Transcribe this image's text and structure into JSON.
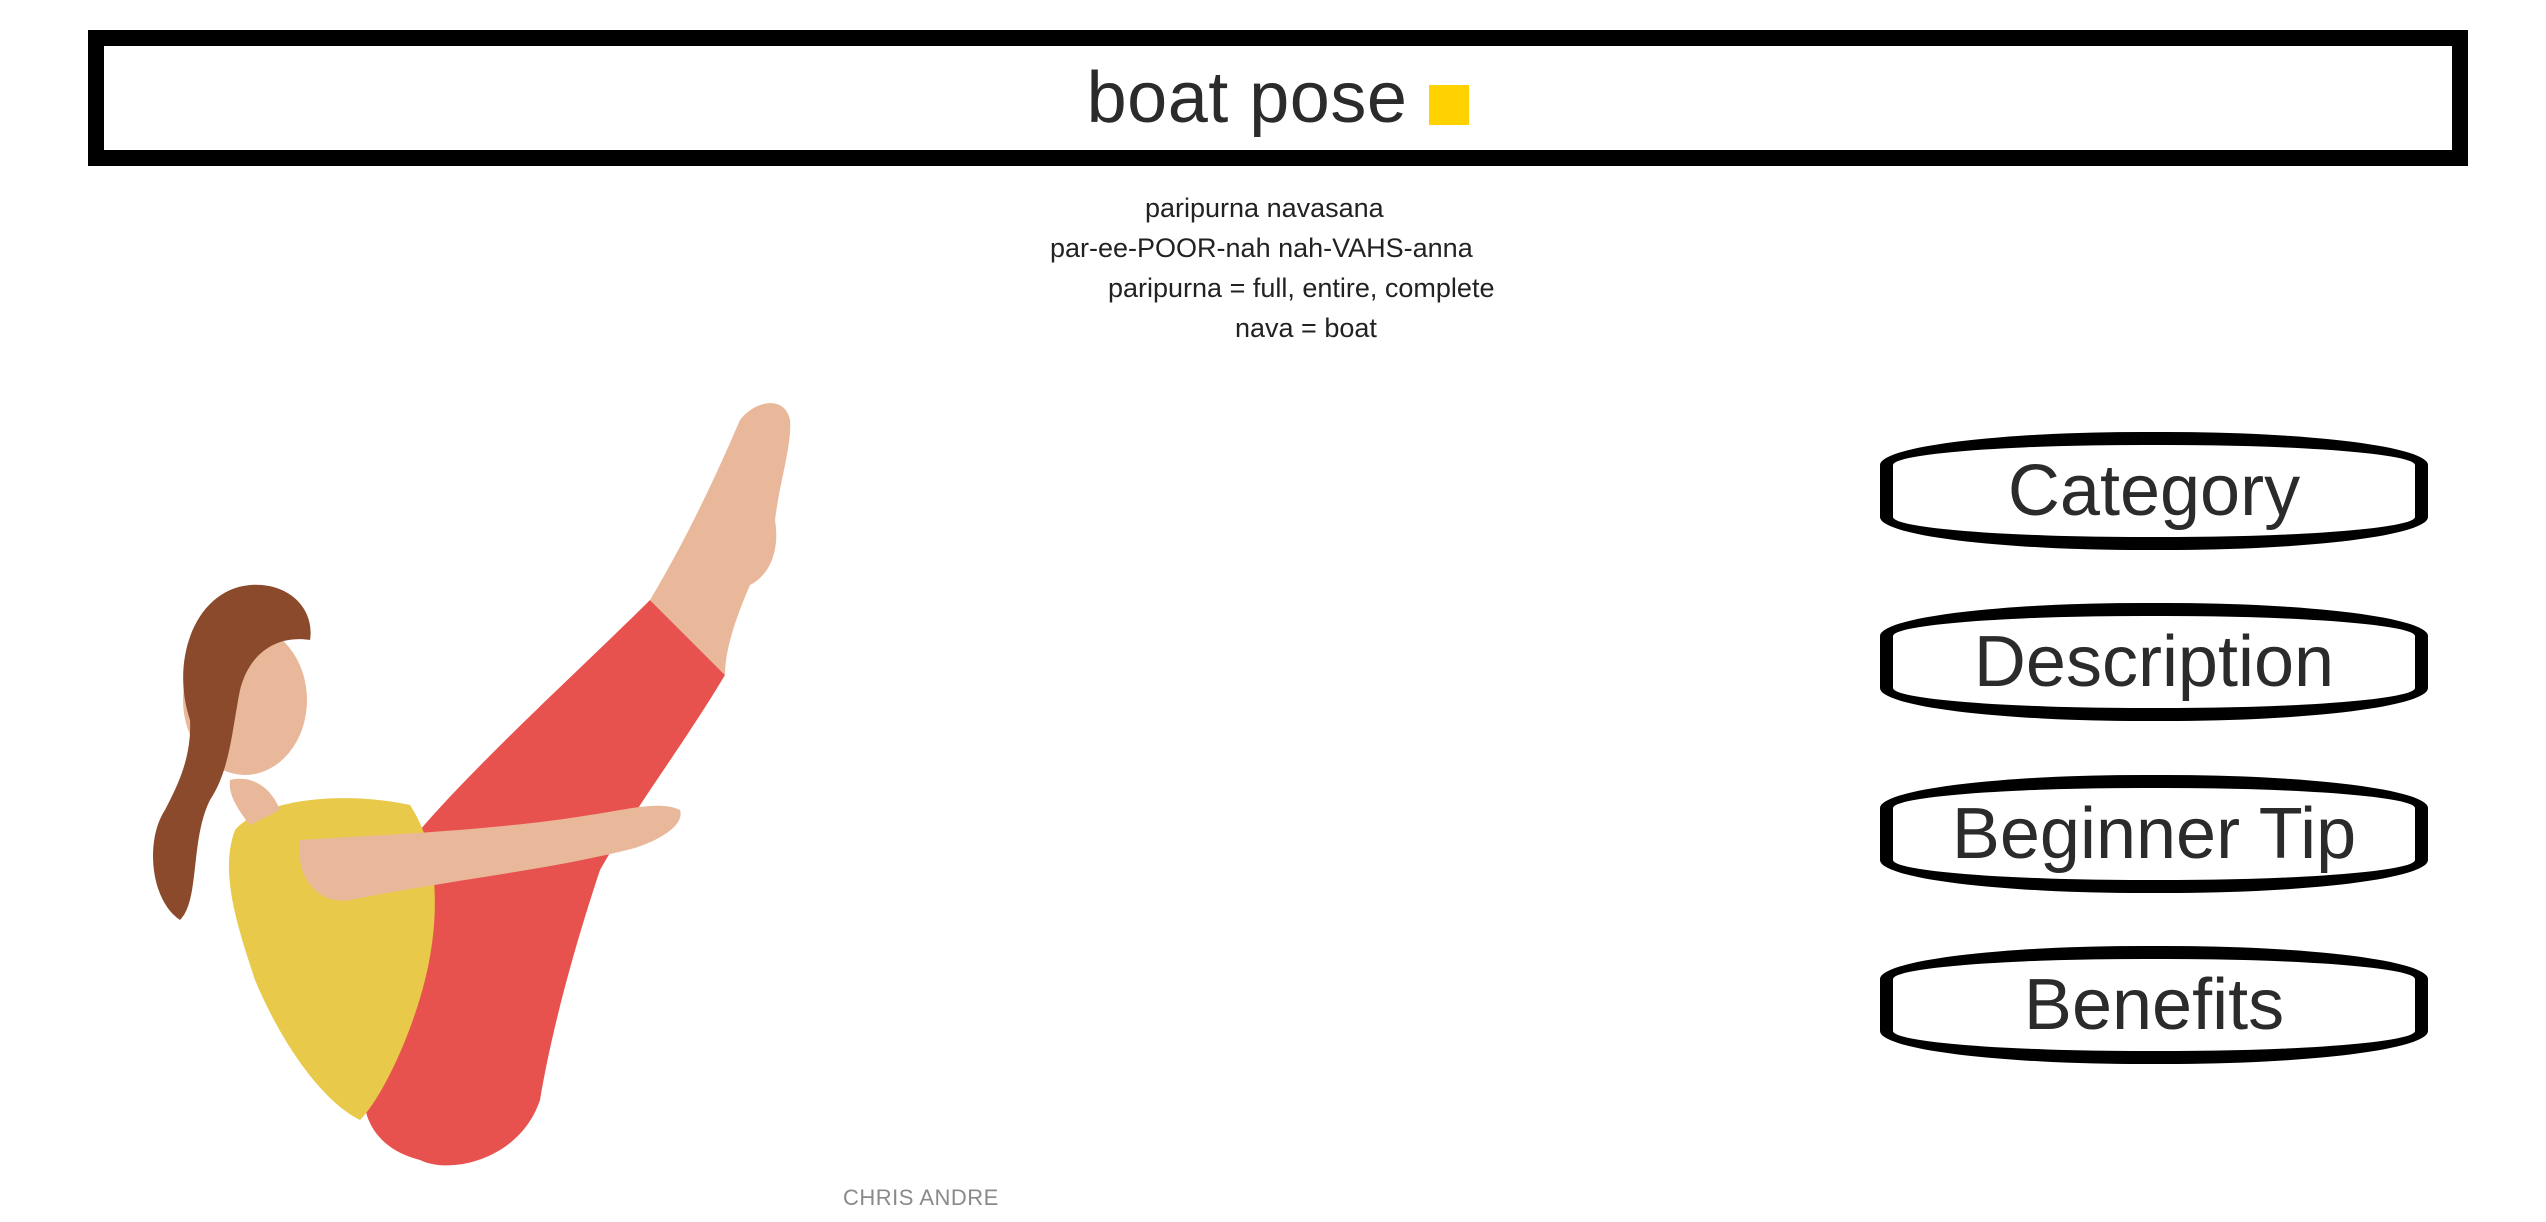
{
  "header": {
    "title": "boat pose",
    "accent_color": "#FFD200"
  },
  "pose": {
    "sanskrit": "paripurna navasana",
    "pronunciation": "par-ee-POOR-nah nah-VAHS-anna",
    "translation_1": "paripurna = full, entire, complete",
    "translation_2": "nava = boat"
  },
  "photo": {
    "credit": "CHRIS ANDRE"
  },
  "menu": {
    "items": [
      {
        "label": "Category"
      },
      {
        "label": "Description"
      },
      {
        "label": "Beginner Tip"
      },
      {
        "label": "Benefits"
      }
    ]
  }
}
